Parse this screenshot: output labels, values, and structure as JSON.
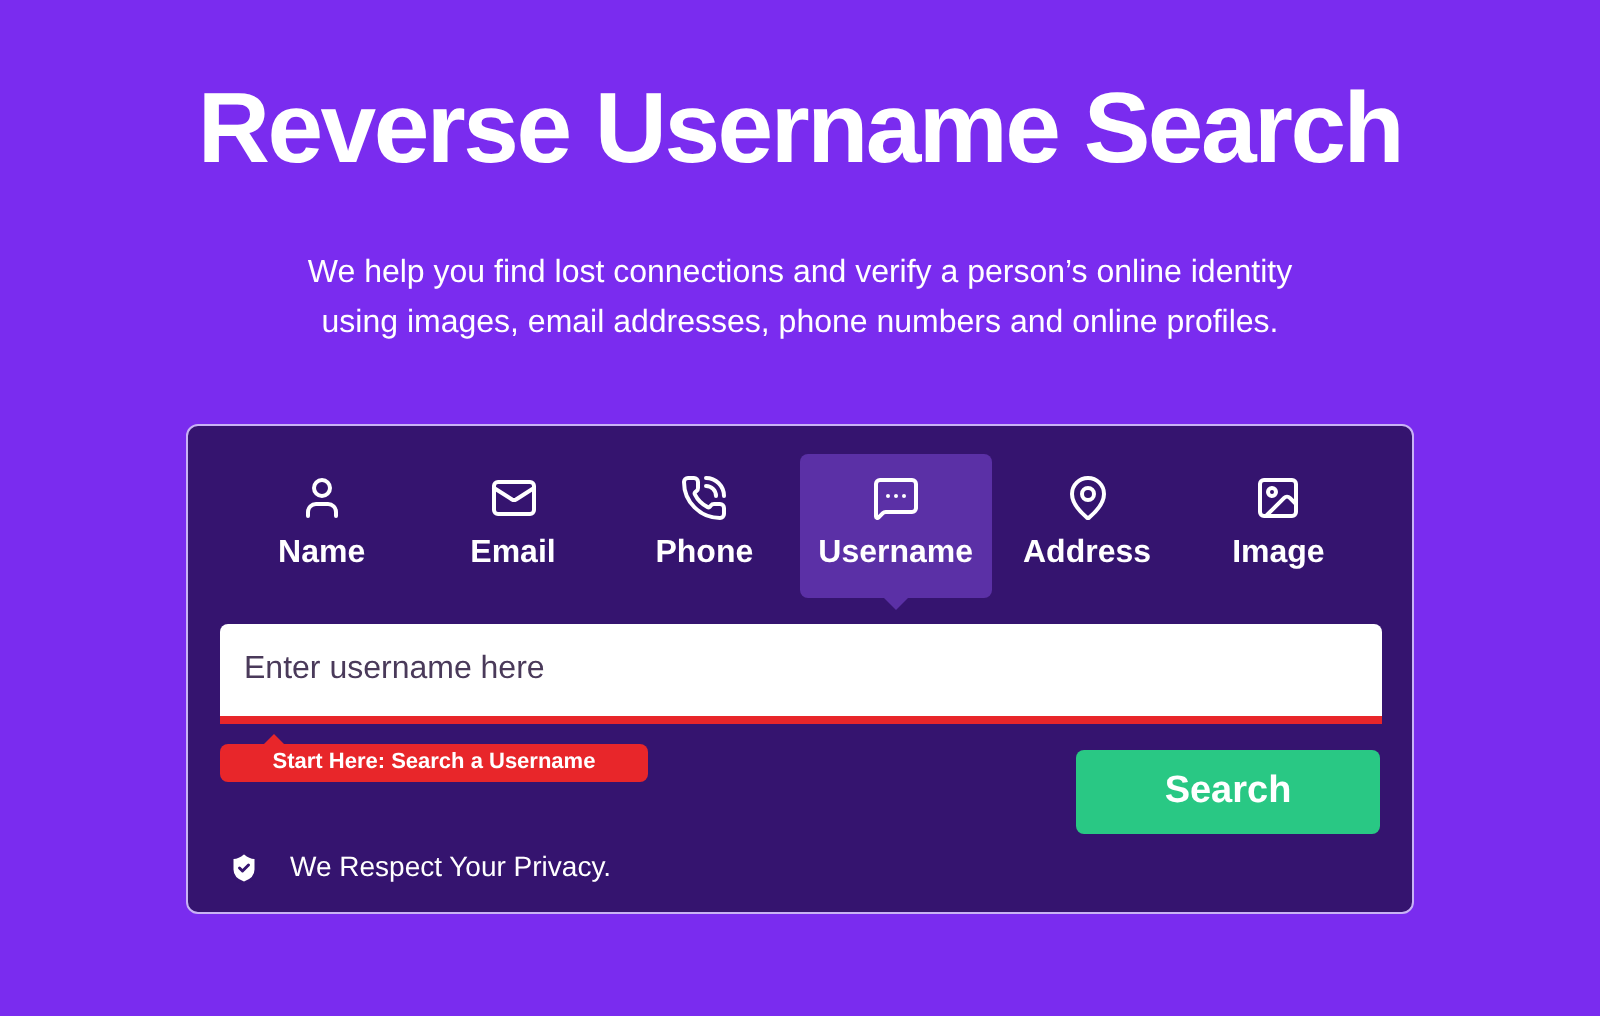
{
  "title": "Reverse Username Search",
  "subtitle": "We help you find lost connections and verify a person’s online identity using images, email addresses, phone numbers and online profiles.",
  "tabs": [
    {
      "kind": "name",
      "label": "Name",
      "selected": false
    },
    {
      "kind": "email",
      "label": "Email",
      "selected": false
    },
    {
      "kind": "phone",
      "label": "Phone",
      "selected": false
    },
    {
      "kind": "username",
      "label": "Username",
      "selected": true
    },
    {
      "kind": "address",
      "label": "Address",
      "selected": false
    },
    {
      "kind": "image",
      "label": "Image",
      "selected": false
    }
  ],
  "search": {
    "placeholder": "Enter username here",
    "hint": "Start Here: Search a Username",
    "button": "Search"
  },
  "privacy": "We Respect Your Privacy."
}
